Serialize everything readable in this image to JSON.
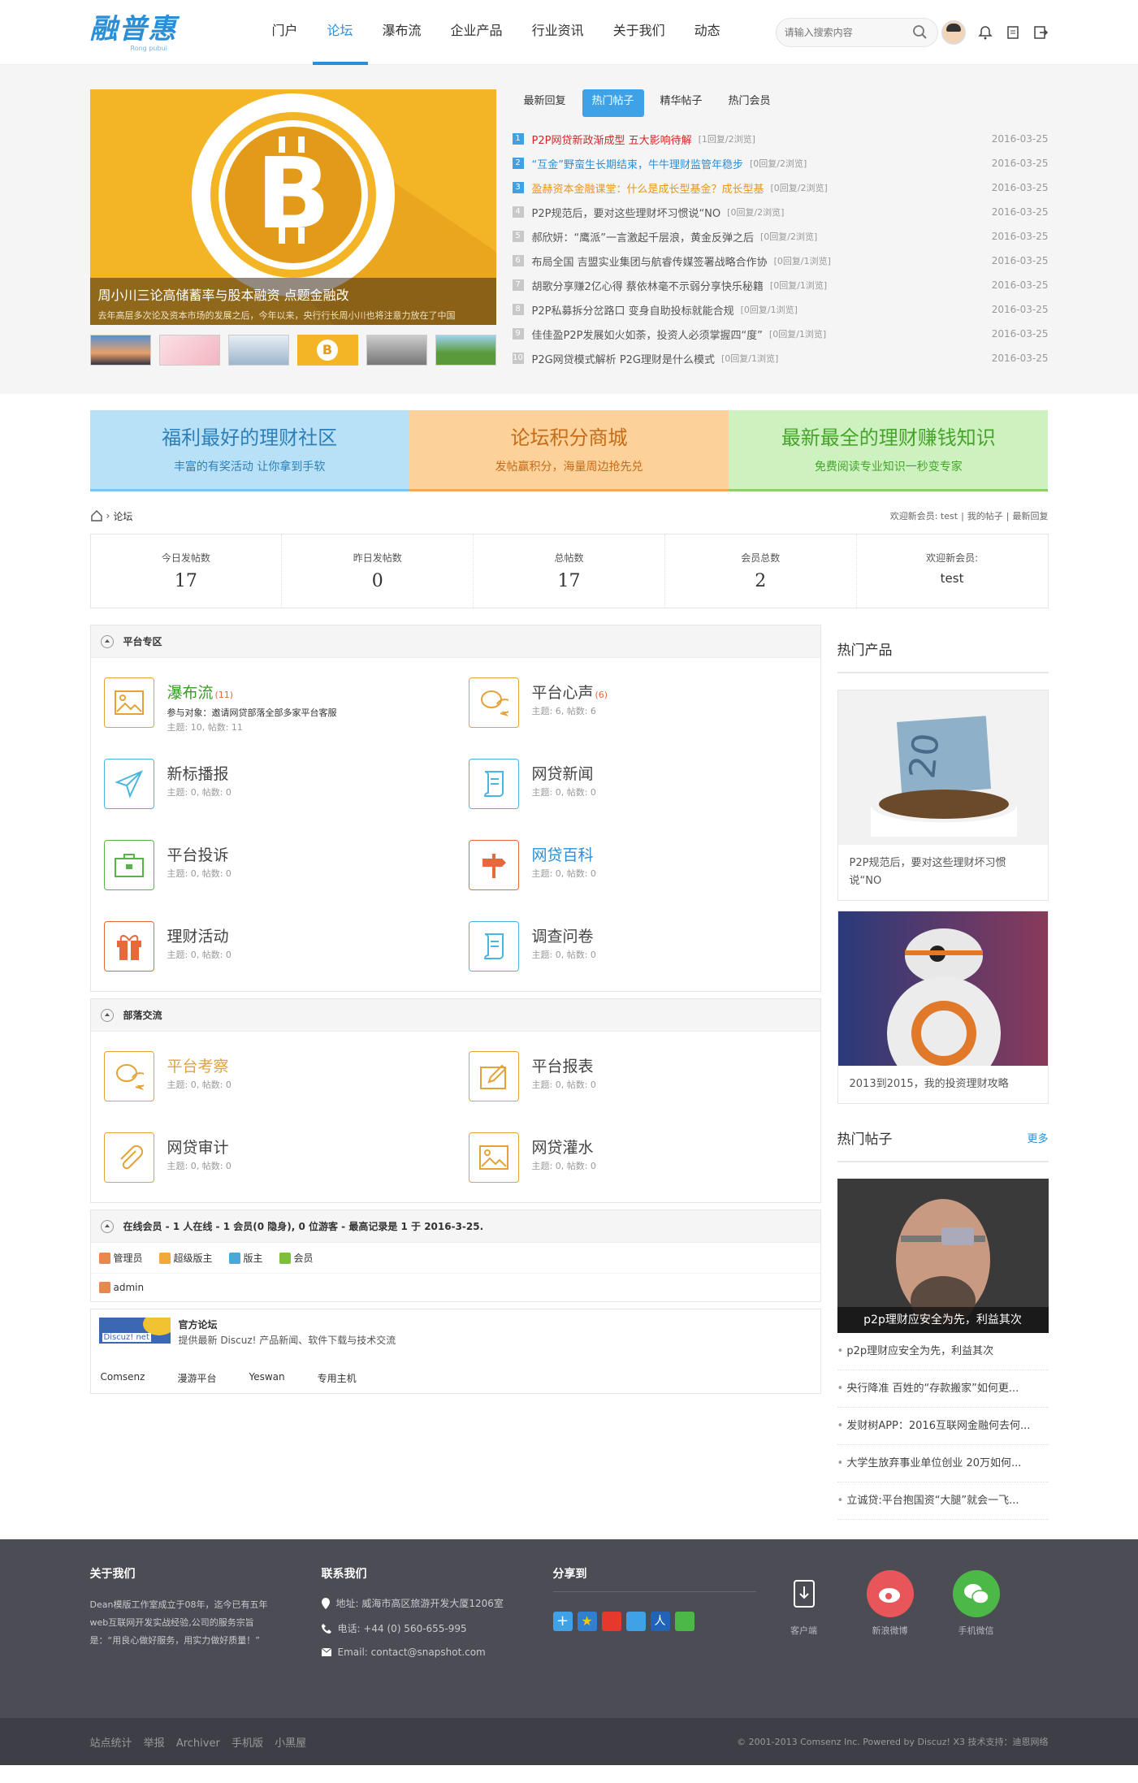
{
  "header": {
    "logo_text": "融普惠",
    "logo_sub": "Rong pubui",
    "nav": [
      "门户",
      "论坛",
      "瀑布流",
      "企业产品",
      "行业资讯",
      "关于我们",
      "动态"
    ],
    "search_placeholder": "请输入搜索内容"
  },
  "top": {
    "slide_title": "周小川三论高储蓄率与股本融资 点题金融改",
    "slide_desc": "去年高层多次论及资本市场的发展之后，今年以来，央行行长周小川也将注意力放在了中国",
    "tabs": [
      "最新回复",
      "热门帖子",
      "精华帖子",
      "热门会员"
    ],
    "posts": [
      {
        "num": "1",
        "title": "P2P网贷新政渐成型 五大影响待解",
        "meta": "[1回复/2浏览]",
        "date": "2016-03-25"
      },
      {
        "num": "2",
        "title": "“互金”野蛮生长期结束，牛牛理财监管年稳步",
        "meta": "[0回复/2浏览]",
        "date": "2016-03-25"
      },
      {
        "num": "3",
        "title": "盈赫资本金融课堂：什么是成长型基金？成长型基",
        "meta": "[0回复/2浏览]",
        "date": "2016-03-25"
      },
      {
        "num": "4",
        "title": "P2P规范后，要对这些理财坏习惯说“NO",
        "meta": "[0回复/2浏览]",
        "date": "2016-03-25"
      },
      {
        "num": "5",
        "title": "郝欣妍：“鹰派”一言激起千层浪，黄金反弹之后",
        "meta": "[0回复/2浏览]",
        "date": "2016-03-25"
      },
      {
        "num": "6",
        "title": "布局全国 吉盟实业集团与航睿传媒签署战略合作协",
        "meta": "[0回复/1浏览]",
        "date": "2016-03-25"
      },
      {
        "num": "7",
        "title": "胡歌分享赚2亿心得 蔡依林毫不示弱分享快乐秘籍",
        "meta": "[0回复/1浏览]",
        "date": "2016-03-25"
      },
      {
        "num": "8",
        "title": "P2P私募拆分岔路口 变身自助投标就能合规",
        "meta": "[0回复/1浏览]",
        "date": "2016-03-25"
      },
      {
        "num": "9",
        "title": "佳佳盈P2P发展如火如荼，投资人必须掌握四“度”",
        "meta": "[0回复/1浏览]",
        "date": "2016-03-25"
      },
      {
        "num": "10",
        "title": "P2G网贷模式解析 P2G理财是什么模式",
        "meta": "[0回复/1浏览]",
        "date": "2016-03-25"
      }
    ]
  },
  "banners": [
    {
      "title": "福利最好的理财社区",
      "sub": "丰富的有奖活动 让你拿到手软"
    },
    {
      "title": "论坛积分商城",
      "sub": "发帖赢积分，海量周边抢先兑"
    },
    {
      "title": "最新最全的理财赚钱知识",
      "sub": "免费阅读专业知识一秒变专家"
    }
  ],
  "crumb": {
    "current": "论坛",
    "new_member": "欢迎新会员: test",
    "my_posts": "我的帖子",
    "latest": "最新回复"
  },
  "stats": [
    {
      "label": "今日发帖数",
      "value": "17"
    },
    {
      "label": "昨日发帖数",
      "value": "0"
    },
    {
      "label": "总帖数",
      "value": "17"
    },
    {
      "label": "会员总数",
      "value": "2"
    },
    {
      "label": "欢迎新会员:",
      "value": "test"
    }
  ],
  "sections": {
    "s1": {
      "title": "平台专区"
    },
    "s2": {
      "title": "部落交流"
    },
    "s3": {
      "title": "在线会员 - 1 人在线 - 1 会员(0 隐身), 0 位游客 - 最高记录是 1 于 2016-3-25."
    }
  },
  "forums1": [
    {
      "name": "瀑布流",
      "count": "(11)",
      "desc": "参与对象：邀请网贷部落全部多家平台客服",
      "meta": "主题: 10, 帖数: 11"
    },
    {
      "name": "平台心声",
      "count": "(6)",
      "desc": "",
      "meta": "主题: 6, 帖数: 6"
    },
    {
      "name": "新标播报",
      "count": "",
      "desc": "",
      "meta": "主题: 0, 帖数: 0"
    },
    {
      "name": "网贷新闻",
      "count": "",
      "desc": "",
      "meta": "主题: 0, 帖数: 0"
    },
    {
      "name": "平台投诉",
      "count": "",
      "desc": "",
      "meta": "主题: 0, 帖数: 0"
    },
    {
      "name": "网贷百科",
      "count": "",
      "desc": "",
      "meta": "主题: 0, 帖数: 0"
    },
    {
      "name": "理财活动",
      "count": "",
      "desc": "",
      "meta": "主题: 0, 帖数: 0"
    },
    {
      "name": "调查问卷",
      "count": "",
      "desc": "",
      "meta": "主题: 0, 帖数: 0"
    }
  ],
  "forums2": [
    {
      "name": "平台考察",
      "meta": "主题: 0, 帖数: 0"
    },
    {
      "name": "平台报表",
      "meta": "主题: 0, 帖数: 0"
    },
    {
      "name": "网贷审计",
      "meta": "主题: 0, 帖数: 0"
    },
    {
      "name": "网贷灌水",
      "meta": "主题: 0, 帖数: 0"
    }
  ],
  "online": {
    "groups": [
      "管理员",
      "超级版主",
      "版主",
      "会员"
    ],
    "user": "admin"
  },
  "links": {
    "logo_text": "Discuz! net",
    "title": "官方论坛",
    "desc": "提供最新 Discuz! 产品新闻、软件下载与技术交流",
    "text_links": [
      "Comsenz",
      "漫游平台",
      "Yeswan",
      "专用主机"
    ]
  },
  "side": {
    "hot_products": "热门产品",
    "products": [
      {
        "caption": "P2P规范后，要对这些理财坏习惯说“NO"
      },
      {
        "caption": "2013到2015，我的投资理财攻略"
      }
    ],
    "hot_posts": "热门帖子",
    "more": "更多",
    "hot_img_caption": "p2p理财应安全为先，利益其次",
    "hot_list": [
      "p2p理财应安全为先，利益其次",
      "央行降准 百姓的“存款搬家”如何更...",
      "发财树APP：2016互联网金融何去何...",
      "大学生放弃事业单位创业 20万如何...",
      "立诚贷:平台抱国资“大腿”就会一飞..."
    ]
  },
  "footer": {
    "about_title": "关于我们",
    "about_text": "Dean模版工作室成立于08年，迄今已有五年web互联网开发实战经验,公司的服务宗旨是：“用良心做好服务，用实力做好质量！”",
    "contact_title": "联系我们",
    "address": "地址: 威海市高区旅游开发大厦1206室",
    "phone": "电话: +44 (0) 560-655-995",
    "email": "Email: contact@snapshot.com",
    "share_title": "分享到",
    "apps": [
      "客户端",
      "新浪微博",
      "手机微信"
    ]
  },
  "bottom": {
    "links": [
      "站点统计",
      "举报",
      "Archiver",
      "手机版",
      "小黑屋"
    ],
    "copyright": "© 2001-2013 Comsenz Inc.  Powered by Discuz! X3  技术支持：迪恩网络"
  }
}
